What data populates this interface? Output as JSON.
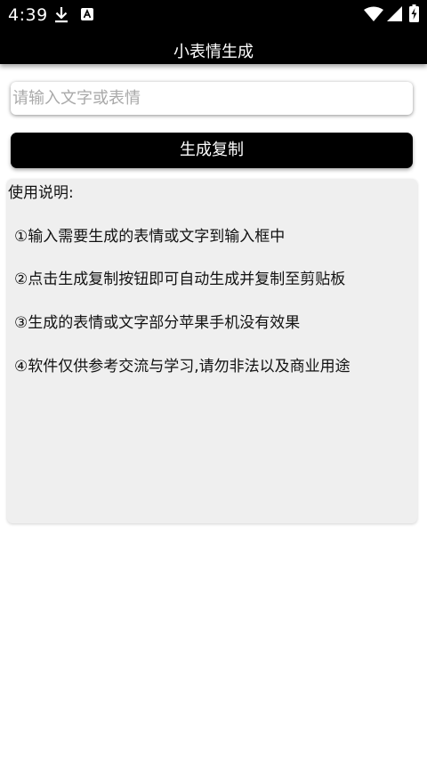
{
  "status_bar": {
    "time": "4:39",
    "left_icons": [
      "download-icon",
      "assistant-icon"
    ],
    "right_icons": [
      "wifi-icon",
      "cell-signal-icon",
      "battery-charging-icon"
    ]
  },
  "app_bar": {
    "title": "小表情生成"
  },
  "input": {
    "value": "",
    "placeholder": "请输入文字或表情"
  },
  "generate_button": {
    "label": "生成复制"
  },
  "instructions": {
    "title": "使用说明:",
    "items": [
      "①输入需要生成的表情或文字到输入框中",
      "②点击生成复制按钮即可自动生成并复制至剪贴板",
      "③生成的表情或文字部分苹果手机没有效果",
      "④软件仅供参考交流与学习,请勿非法以及商业用途"
    ]
  },
  "colors": {
    "bar_background": "#000000",
    "button_background": "#000000",
    "panel_background": "#efefef",
    "placeholder_text": "#a9a9a9"
  }
}
